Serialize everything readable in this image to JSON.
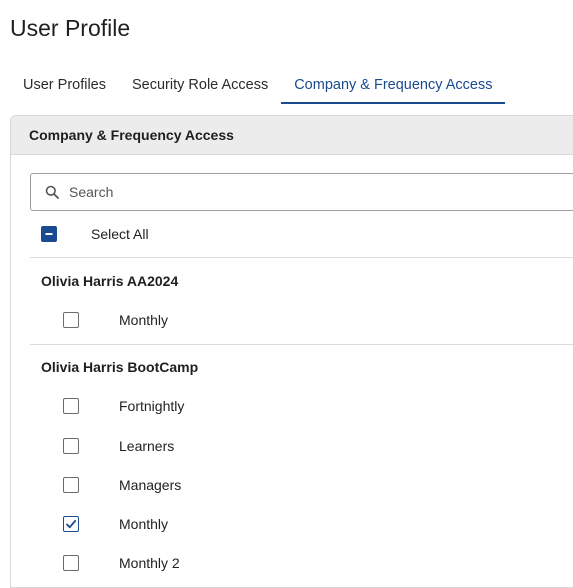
{
  "page": {
    "title": "User Profile"
  },
  "tabs": [
    {
      "label": "User Profiles",
      "active": false
    },
    {
      "label": "Security Role Access",
      "active": false
    },
    {
      "label": "Company & Frequency Access",
      "active": true
    }
  ],
  "panel": {
    "header": "Company & Frequency Access",
    "search_placeholder": "Search",
    "select_all": {
      "label": "Select All",
      "state": "indeterminate"
    },
    "groups": [
      {
        "name": "Olivia Harris AA2024",
        "items": [
          {
            "label": "Monthly",
            "checked": false
          }
        ]
      },
      {
        "name": "Olivia Harris BootCamp",
        "items": [
          {
            "label": "Fortnightly",
            "checked": false
          },
          {
            "label": "Learners",
            "checked": false
          },
          {
            "label": "Managers",
            "checked": false
          },
          {
            "label": "Monthly",
            "checked": true
          },
          {
            "label": "Monthly 2",
            "checked": false
          }
        ]
      }
    ]
  },
  "colors": {
    "accent": "#1a4a8f",
    "header_bg": "#ececec"
  }
}
